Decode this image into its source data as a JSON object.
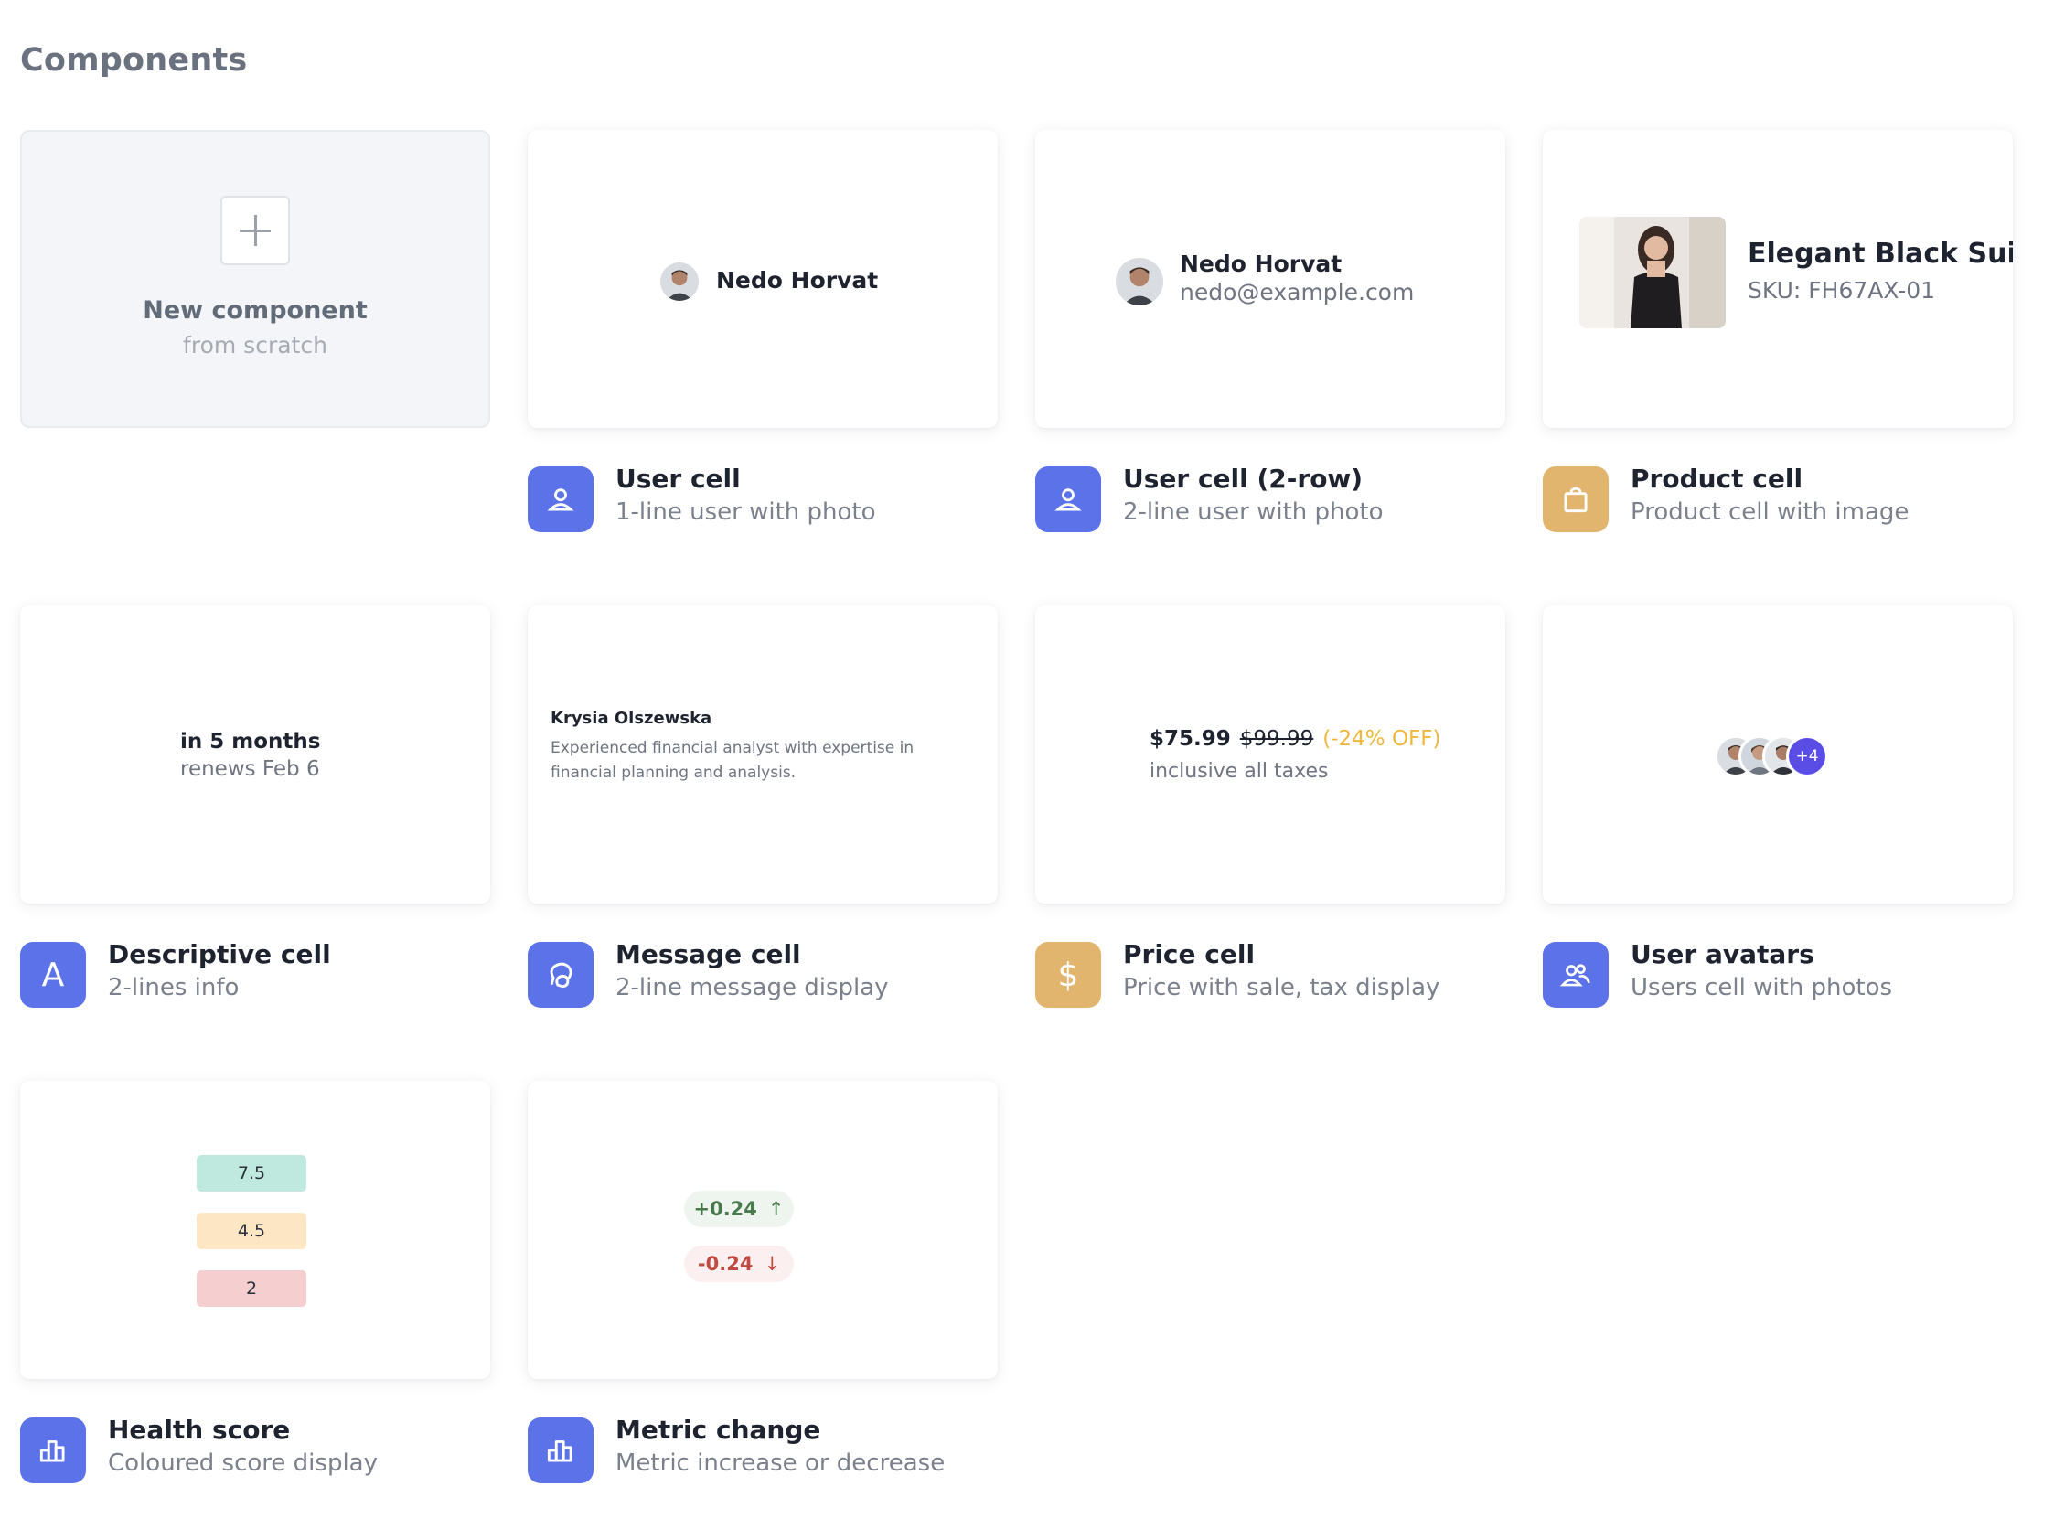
{
  "page": {
    "title": "Components"
  },
  "new_component": {
    "title": "New component",
    "subtitle": "from scratch"
  },
  "components": [
    {
      "title": "User cell",
      "subtitle": "1-line user with photo",
      "icon": "user-icon",
      "color": "#5b72e8"
    },
    {
      "title": "User cell (2-row)",
      "subtitle": "2-line user with photo",
      "icon": "user-icon",
      "color": "#5b72e8"
    },
    {
      "title": "Product cell",
      "subtitle": "Product cell with image",
      "icon": "shopping-bag-icon",
      "color": "#e2b56e"
    },
    {
      "title": "Descriptive cell",
      "subtitle": "2-lines info",
      "icon": "letter-a-icon",
      "color": "#5b72e8"
    },
    {
      "title": "Message cell",
      "subtitle": "2-line message display",
      "icon": "message-icon",
      "color": "#5b72e8"
    },
    {
      "title": "Price cell",
      "subtitle": "Price with sale, tax display",
      "icon": "dollar-icon",
      "color": "#e2b56e"
    },
    {
      "title": "User avatars",
      "subtitle": "Users cell with photos",
      "icon": "users-icon",
      "color": "#5b72e8"
    },
    {
      "title": "Health score",
      "subtitle": "Coloured score display",
      "icon": "bar-chart-icon",
      "color": "#5b72e8"
    },
    {
      "title": "Metric change",
      "subtitle": "Metric increase or decrease",
      "icon": "bar-chart-icon",
      "color": "#5b72e8"
    }
  ],
  "previews": {
    "user_cell": {
      "name": "Nedo Horvat"
    },
    "user_cell_2row": {
      "name": "Nedo Horvat",
      "email": "nedo@example.com"
    },
    "product_cell": {
      "name": "Elegant Black Suit",
      "sku": "SKU: FH67AX-01"
    },
    "descriptive_cell": {
      "line1": "in 5 months",
      "line2": "renews Feb 6"
    },
    "message_cell": {
      "name": "Krysia Olszewska",
      "text": "Experienced financial analyst with expertise in financial planning and analysis."
    },
    "price_cell": {
      "price": "$75.99",
      "original_price": "$99.99",
      "discount": "(-24% OFF)",
      "note": "inclusive all taxes",
      "discount_color": "#f0b73e"
    },
    "user_avatars": {
      "more": "+4",
      "count_shown": 3
    },
    "health_score": {
      "scores": [
        {
          "value": "7.5",
          "color": "#bfe9df"
        },
        {
          "value": "4.5",
          "color": "#fde6c4"
        },
        {
          "value": "2",
          "color": "#f5cfcf"
        }
      ]
    },
    "metric_change": {
      "up": {
        "value": "+0.24",
        "arrow": "↑",
        "color": "#487a4c"
      },
      "down": {
        "value": "-0.24",
        "arrow": "↓",
        "color": "#c14b44"
      }
    }
  }
}
